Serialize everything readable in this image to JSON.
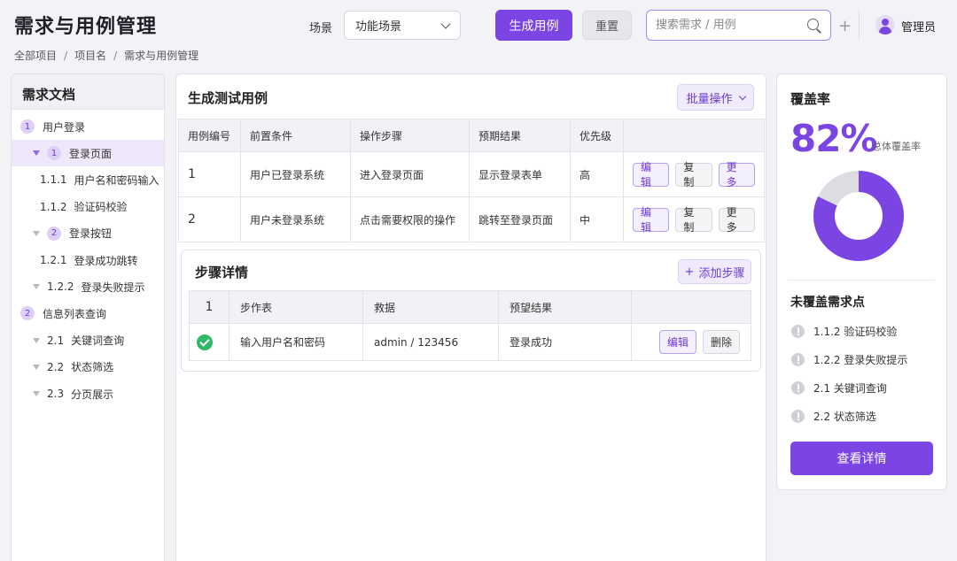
{
  "header": {
    "title": "需求与用例管理",
    "scene_label": "场景",
    "scene_value": "功能场景",
    "generate_label": "生成用例",
    "reset_label": "重置",
    "search_placeholder": "搜索需求 / 用例",
    "plus": "+",
    "user_name": "管理员"
  },
  "breadcrumb": [
    "全部项目",
    "项目名",
    "需求与用例管理"
  ],
  "breadcrumb_sep": "/",
  "sidebar": {
    "title": "需求文档",
    "items": [
      {
        "marker": "circle",
        "badge": "1",
        "num": "",
        "label": "用户登录",
        "active": false
      },
      {
        "marker": "tri-circle",
        "badge": "1",
        "num": "",
        "label": "登录页面",
        "active": true
      },
      {
        "marker": "none",
        "badge": "",
        "num": "1.1.1",
        "label": "用户名和密码输入",
        "active": false
      },
      {
        "marker": "none",
        "badge": "",
        "num": "1.1.2",
        "label": "验证码校验",
        "active": false
      },
      {
        "marker": "tri-circle",
        "badge": "2",
        "num": "",
        "label": "登录按钮",
        "active": false
      },
      {
        "marker": "none",
        "badge": "",
        "num": "1.2.1",
        "label": "登录成功跳转",
        "active": false
      },
      {
        "marker": "tri",
        "badge": "",
        "num": "1.2.2",
        "label": "登录失败提示",
        "active": false
      },
      {
        "marker": "circle",
        "badge": "2",
        "num": "",
        "label": "信息列表查询",
        "active": false
      },
      {
        "marker": "tri",
        "badge": "",
        "num": "2.1",
        "label": "关键词查询",
        "active": false
      },
      {
        "marker": "tri",
        "badge": "",
        "num": "2.2",
        "label": "状态筛选",
        "active": false
      },
      {
        "marker": "tri",
        "badge": "",
        "num": "2.3",
        "label": "分页展示",
        "active": false
      }
    ]
  },
  "main": {
    "title": "生成测试用例",
    "batch_label": "批量操作",
    "columns": [
      "用例编号",
      "前置条件",
      "操作步骤",
      "预期结果",
      "优先级",
      ""
    ],
    "rows": [
      {
        "id": "1",
        "pre": "用户已登录系统",
        "step": "进入登录页面",
        "expect": "显示登录表单",
        "priority": "高",
        "ops": [
          "编辑",
          "复制",
          "更多"
        ]
      },
      {
        "id": "2",
        "pre": "用户未登录系统",
        "step": "点击需要权限的操作",
        "expect": "跳转至登录页面",
        "priority": "中",
        "ops": [
          "编辑",
          "复制",
          "更多"
        ]
      }
    ],
    "detail": {
      "title": "步骤详情",
      "add_label": "添加步骤",
      "columns": [
        "1",
        "步作表",
        "救据",
        "预望结果",
        ""
      ],
      "rows": [
        {
          "action": "输入用户名和密码",
          "data": "admin / 123456",
          "expect": "登录成功",
          "ops": [
            "编辑",
            "删除"
          ]
        }
      ]
    }
  },
  "coverage": {
    "title": "覆盖率",
    "percent_text": "82%",
    "percent": 82,
    "percent_label": "总体覆盖率",
    "colors": {
      "covered": "#7b45e3",
      "uncovered": "#dcdce2"
    },
    "uncovered_title": "未覆盖需求点",
    "uncovered_items": [
      "1.1.2  验证码校验",
      "1.2.2  登录失败提示",
      "2.1  关键词查询",
      "2.2  状态筛选"
    ],
    "view_label": "查看详情"
  }
}
